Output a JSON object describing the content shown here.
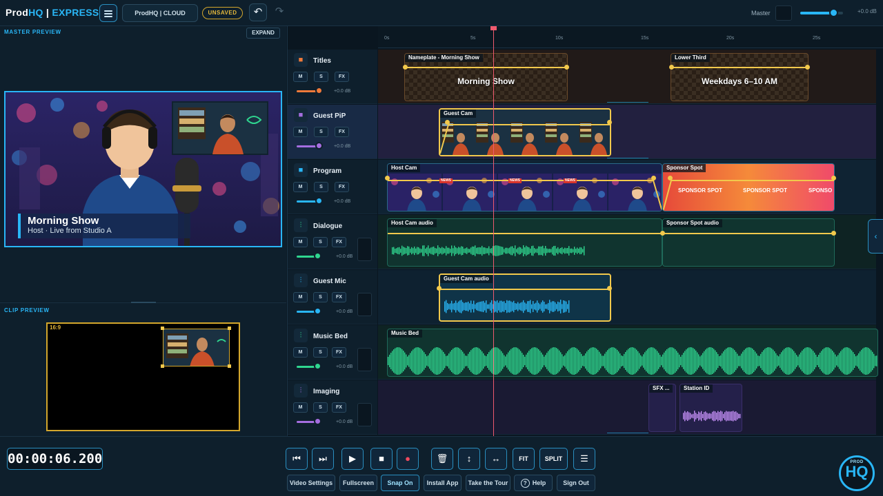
{
  "app": {
    "logo_prod": "Prod",
    "logo_hq": "HQ",
    "logo_sep": " | ",
    "logo_express": "EXPRESS",
    "cloud_label": "ProdHQ | CLOUD",
    "unsaved_label": "UNSAVED"
  },
  "header": {
    "master_label": "Master",
    "master_db": "+0.0 dB",
    "master_level": 0.78
  },
  "master_preview": {
    "title": "MASTER PREVIEW",
    "expand_label": "EXPAND",
    "lower_third_title": "Morning Show",
    "lower_third_subtitle": "Host · Live from Studio A"
  },
  "clip_preview": {
    "title": "CLIP PREVIEW",
    "aspect": "16:9"
  },
  "ruler": {
    "ticks": [
      "0s",
      "5s",
      "10s",
      "15s",
      "20s",
      "25s"
    ]
  },
  "tracks": [
    {
      "name": "Titles",
      "icon": "video-camera-icon",
      "color": "#f07a3a",
      "db": "+0.0 dB",
      "level": 0.9,
      "m": "M",
      "s": "S",
      "fx": "FX"
    },
    {
      "name": "Guest PiP",
      "icon": "video-camera-icon",
      "color": "#a56ee0",
      "db": "+0.0 dB",
      "level": 0.9,
      "m": "M",
      "s": "S",
      "fx": "FX"
    },
    {
      "name": "Program",
      "icon": "video-camera-icon",
      "color": "#29b6f6",
      "db": "+0.0 dB",
      "level": 0.9,
      "m": "M",
      "s": "S",
      "fx": "FX"
    },
    {
      "name": "Dialogue",
      "icon": "mixer-sliders-icon",
      "color": "#2fd68f",
      "db": "+0.0 dB",
      "level": 0.85,
      "m": "M",
      "s": "S",
      "fx": "FX"
    },
    {
      "name": "Guest Mic",
      "icon": "mixer-sliders-icon",
      "color": "#29b6f6",
      "db": "+0.0 dB",
      "level": 0.85,
      "m": "M",
      "s": "S",
      "fx": "FX"
    },
    {
      "name": "Music Bed",
      "icon": "mixer-sliders-icon",
      "color": "#2fd68f",
      "db": "+0.0 dB",
      "level": 0.85,
      "m": "M",
      "s": "S",
      "fx": "FX"
    },
    {
      "name": "Imaging",
      "icon": "mixer-sliders-icon",
      "color": "#a56ee0",
      "db": "+0.0 dB",
      "level": 0.85,
      "m": "M",
      "s": "S",
      "fx": "FX"
    }
  ],
  "clips": {
    "nameplate": {
      "label": "Nameplate - Morning Show",
      "text": "Morning Show"
    },
    "lower_third": {
      "label": "Lower Third",
      "text": "Weekdays 6–10 AM"
    },
    "guest_cam": {
      "label": "Guest Cam"
    },
    "host_cam": {
      "label": "Host Cam",
      "badge": "NEWS"
    },
    "sponsor_spot": {
      "label": "Sponsor Spot",
      "text": "SPONSOR SPOT",
      "text_cut": "SPONSO"
    },
    "host_cam_audio": {
      "label": "Host Cam audio"
    },
    "sponsor_spot_audio": {
      "label": "Sponsor Spot audio"
    },
    "guest_cam_audio": {
      "label": "Guest Cam audio"
    },
    "music_bed": {
      "label": "Music Bed"
    },
    "sfx": {
      "label": "SFX ..."
    },
    "station_id": {
      "label": "Station ID"
    }
  },
  "transport": {
    "timecode": "00:00:06.200",
    "fit_label": "FIT",
    "split_label": "SPLIT"
  },
  "bottom_buttons": {
    "video_settings": "Video Settings",
    "fullscreen": "Fullscreen",
    "snap": "Snap On",
    "install": "Install App",
    "tour": "Take the Tour",
    "help": "Help",
    "signout": "Sign Out",
    "help_icon": "?"
  },
  "hq_logo": {
    "top": "PROD",
    "main": "HQ"
  }
}
